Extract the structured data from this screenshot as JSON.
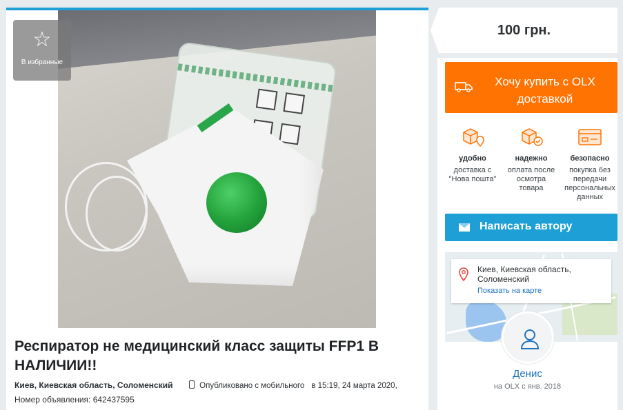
{
  "listing": {
    "favorite_label": "В избранные",
    "title": "Респиратор не медицинский класс защиты FFP1 В НАЛИЧИИ!!",
    "location": "Киев, Киевская область, Соломенский",
    "published": "Опубликовано с мобильного",
    "published_at": "в 15:19, 24 марта 2020,",
    "ad_number": "Номер объявления: 642437595"
  },
  "sidebar": {
    "price": "100 грн.",
    "buy_button": "Хочу купить с OLX доставкой",
    "features": [
      {
        "title": "удобно",
        "text": "доставка с \"Нова пошта\"",
        "icon": "box-location-icon"
      },
      {
        "title": "надежно",
        "text": "оплата после осмотра товара",
        "icon": "box-check-icon"
      },
      {
        "title": "безопасно",
        "text": "покупка без передачи персональных данных",
        "icon": "card-icon"
      }
    ],
    "write_button": "Написать автору",
    "map": {
      "address": "Киев, Киевская область, Соломенский",
      "show_on_map": "Показать на карте"
    },
    "user": {
      "name": "Денис",
      "since": "на OLX с янв. 2018"
    }
  },
  "colors": {
    "accent_blue": "#1e9fd6",
    "buy_orange": "#ff7302",
    "link_blue": "#1e72bd"
  }
}
